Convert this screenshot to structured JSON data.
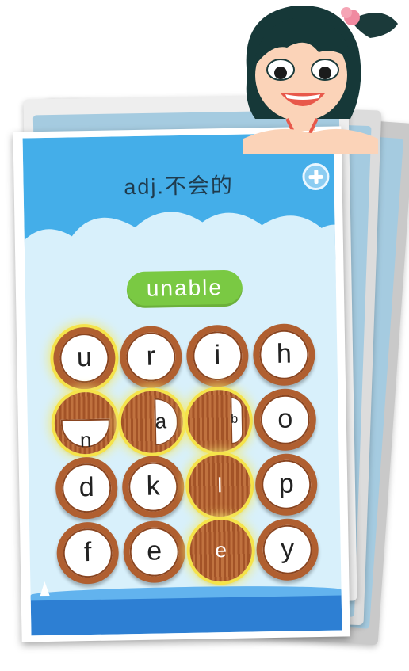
{
  "word_card": {
    "hint": "adj.不会的",
    "answer": "unable"
  },
  "letter_tiles": [
    {
      "letter": "u",
      "state": "selected"
    },
    {
      "letter": "r",
      "state": "normal"
    },
    {
      "letter": "i",
      "state": "normal"
    },
    {
      "letter": "h",
      "state": "normal"
    },
    {
      "letter": "n",
      "state": "flipping"
    },
    {
      "letter": "a",
      "state": "flipping"
    },
    {
      "letter": "b",
      "state": "flipping"
    },
    {
      "letter": "o",
      "state": "normal"
    },
    {
      "letter": "d",
      "state": "normal"
    },
    {
      "letter": "k",
      "state": "normal"
    },
    {
      "letter": "l",
      "state": "flipped"
    },
    {
      "letter": "p",
      "state": "normal"
    },
    {
      "letter": "f",
      "state": "normal"
    },
    {
      "letter": "e",
      "state": "normal"
    },
    {
      "letter": "e",
      "state": "flipped"
    },
    {
      "letter": "y",
      "state": "normal"
    }
  ],
  "colors": {
    "sky": "#44aee9",
    "answer_pill": "#7ac943",
    "tile_wood": "#b05f30",
    "highlight": "#f5e34a",
    "water": "#2d7fd3"
  },
  "icons": [
    "add-icon",
    "mascot-girl",
    "sailboat-icon"
  ]
}
